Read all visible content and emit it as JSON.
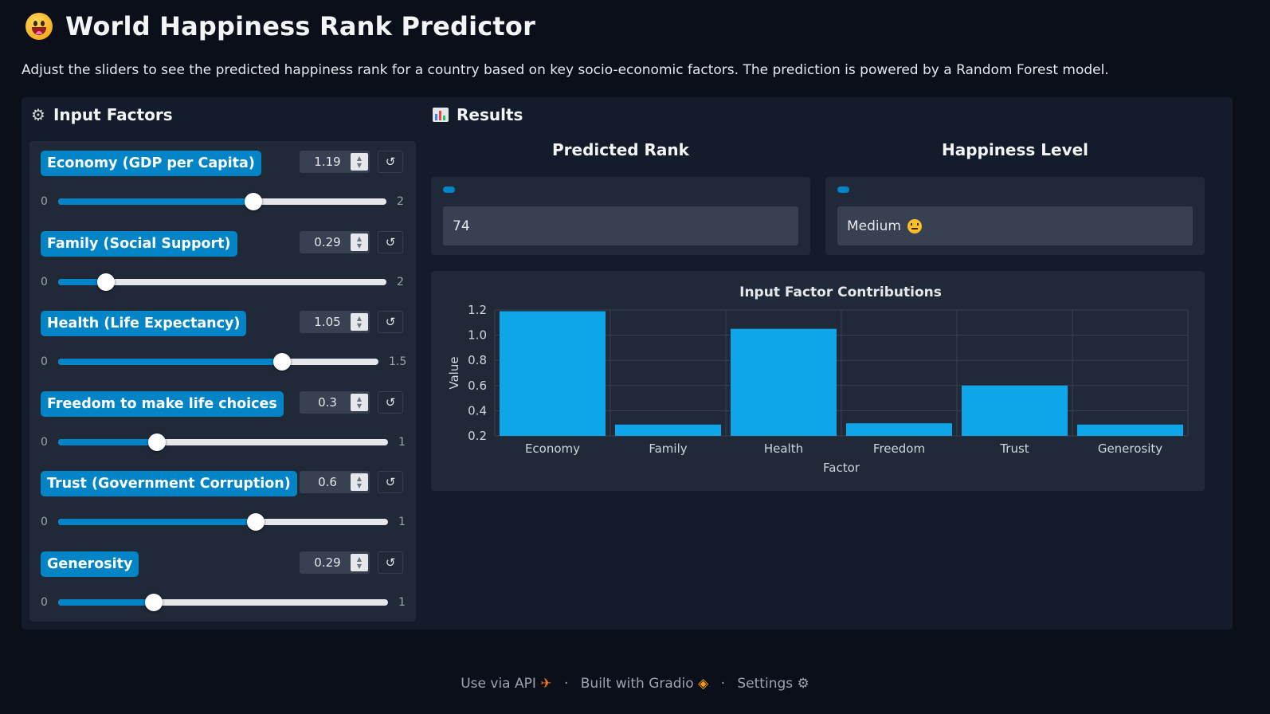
{
  "header": {
    "emoji": "grinning-face",
    "title": "World Happiness Rank Predictor",
    "description": "Adjust the sliders to see the predicted happiness rank for a country based on key socio-economic factors. The prediction is powered by a Random Forest model."
  },
  "inputs": {
    "heading": "Input Factors",
    "icon": "gear-icon",
    "sliders": [
      {
        "label": "Economy (GDP per Capita)",
        "value": "1.19",
        "min": "0",
        "max": "2",
        "fraction": 0.595
      },
      {
        "label": "Family (Social Support)",
        "value": "0.29",
        "min": "0",
        "max": "2",
        "fraction": 0.145
      },
      {
        "label": "Health (Life Expectancy)",
        "value": "1.05",
        "min": "0",
        "max": "1.5",
        "fraction": 0.7
      },
      {
        "label": "Freedom to make life choices",
        "value": "0.3",
        "min": "0",
        "max": "1",
        "fraction": 0.3
      },
      {
        "label": "Trust (Government Corruption)",
        "value": "0.6",
        "min": "0",
        "max": "1",
        "fraction": 0.6
      },
      {
        "label": "Generosity",
        "value": "0.29",
        "min": "0",
        "max": "1",
        "fraction": 0.29
      }
    ]
  },
  "results": {
    "heading": "Results",
    "icon": "bar-chart-icon",
    "predicted_rank": {
      "label": "Predicted Rank",
      "value": "74"
    },
    "happiness_level": {
      "label": "Happiness Level",
      "value": "Medium",
      "emoji": "neutral-face"
    }
  },
  "chart_data": {
    "type": "bar",
    "title": "Input Factor Contributions",
    "xlabel": "Factor",
    "ylabel": "Value",
    "categories": [
      "Economy",
      "Family",
      "Health",
      "Freedom",
      "Trust",
      "Generosity"
    ],
    "values": [
      1.19,
      0.29,
      1.05,
      0.3,
      0.6,
      0.29
    ],
    "ylim": [
      0.2,
      1.2
    ],
    "yticks": [
      "0.2",
      "0.4",
      "0.6",
      "0.8",
      "1.0",
      "1.2"
    ],
    "color": "#0ea5e9",
    "grid": true
  },
  "footer": {
    "api": "Use via API",
    "built": "Built with Gradio",
    "settings": "Settings",
    "separator": "·"
  }
}
